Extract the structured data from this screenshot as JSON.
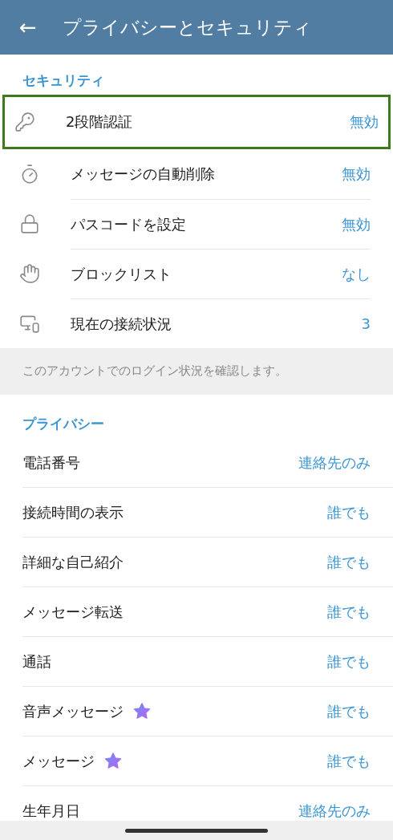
{
  "header": {
    "back": "←",
    "title": "プライバシーとセキュリティ"
  },
  "security": {
    "title": "セキュリティ",
    "items": [
      {
        "kind": "key",
        "label": "2段階認証",
        "value": "無効",
        "selected": true
      },
      {
        "kind": "timer",
        "label": "メッセージの自動削除",
        "value": "無効",
        "selected": false
      },
      {
        "kind": "lock",
        "label": "パスコードを設定",
        "value": "無効",
        "selected": false
      },
      {
        "kind": "hand",
        "label": "ブロックリスト",
        "value": "なし",
        "selected": false
      },
      {
        "kind": "devices",
        "label": "現在の接続状況",
        "value": "3",
        "selected": false
      }
    ],
    "footer": "このアカウントでのログイン状況を確認します。"
  },
  "privacy": {
    "title": "プライバシー",
    "items": [
      {
        "label": "電話番号",
        "value": "連絡先のみ",
        "premium": false
      },
      {
        "label": "接続時間の表示",
        "value": "誰でも",
        "premium": false
      },
      {
        "label": "詳細な自己紹介",
        "value": "誰でも",
        "premium": false
      },
      {
        "label": "メッセージ転送",
        "value": "誰でも",
        "premium": false
      },
      {
        "label": "通話",
        "value": "誰でも",
        "premium": false
      },
      {
        "label": "音声メッセージ",
        "value": "誰でも",
        "premium": true
      },
      {
        "label": "メッセージ",
        "value": "誰でも",
        "premium": true
      },
      {
        "label": "生年月日",
        "value": "連絡先のみ",
        "premium": false
      }
    ]
  }
}
